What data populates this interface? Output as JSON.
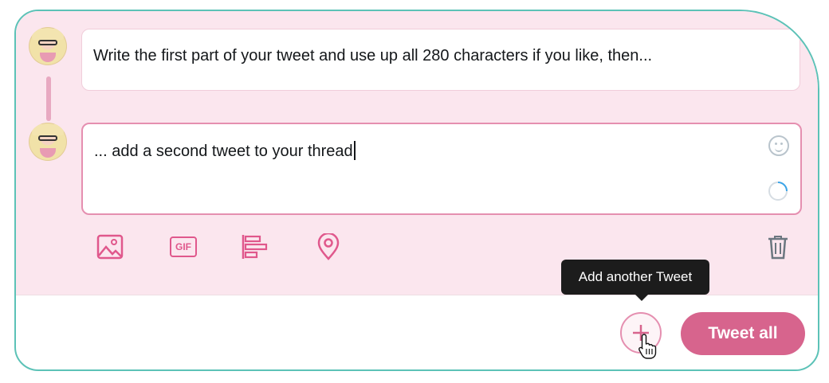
{
  "composer": {
    "tweets": [
      {
        "text": "Write the first part of your tweet and use up all 280 characters if you like, then..."
      },
      {
        "text": "... add a second tweet to your thread"
      }
    ],
    "toolbar": {
      "icons": [
        "image-icon",
        "gif-icon",
        "poll-icon",
        "location-icon",
        "trash-icon"
      ],
      "gif_label": "GIF"
    },
    "tooltip": "Add another Tweet",
    "add_button_symbol": "+",
    "tweet_all_label": "Tweet all"
  },
  "colors": {
    "accent": "#e0588c",
    "button": "#d7648d",
    "frame": "#5cc2b7",
    "panel": "#fbe6ee"
  }
}
